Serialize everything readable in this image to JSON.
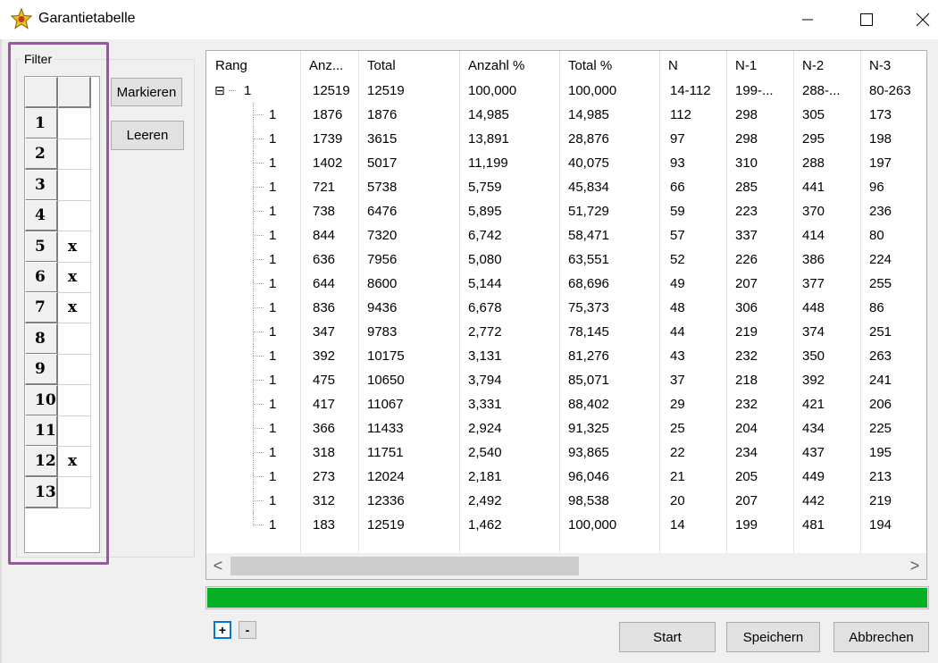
{
  "window": {
    "title": "Garantietabelle",
    "controls": {
      "minimize": "—",
      "maximize": "☐",
      "close": "✕"
    }
  },
  "filter": {
    "legend": "Filter",
    "rows": [
      {
        "label": "1",
        "value": ""
      },
      {
        "label": "2",
        "value": ""
      },
      {
        "label": "3",
        "value": ""
      },
      {
        "label": "4",
        "value": ""
      },
      {
        "label": "5",
        "value": "x"
      },
      {
        "label": "6",
        "value": "x"
      },
      {
        "label": "7",
        "value": "x"
      },
      {
        "label": "8",
        "value": ""
      },
      {
        "label": "9",
        "value": ""
      },
      {
        "label": "10",
        "value": ""
      },
      {
        "label": "11",
        "value": ""
      },
      {
        "label": "12",
        "value": "x"
      },
      {
        "label": "13",
        "value": ""
      }
    ],
    "highlight_color": "#a052ab"
  },
  "buttons": {
    "markieren": "Markieren",
    "leeren": "Leeren",
    "start": "Start",
    "speichern": "Speichern",
    "abbrechen": "Abbrechen",
    "expand": "+",
    "collapse": "-"
  },
  "table": {
    "columns": [
      "Rang",
      "Anz...",
      "Total",
      "Anzahl %",
      "Total %",
      "N",
      "N-1",
      "N-2",
      "N-3"
    ],
    "root": {
      "toggle": "⊟",
      "cells": [
        "1",
        "12519",
        "12519",
        "100,000",
        "100,000",
        "14-112",
        "199-...",
        "288-...",
        "80-263"
      ]
    },
    "rows": [
      [
        "1",
        "1876",
        "1876",
        "14,985",
        "14,985",
        "112",
        "298",
        "305",
        "173"
      ],
      [
        "1",
        "1739",
        "3615",
        "13,891",
        "28,876",
        "97",
        "298",
        "295",
        "198"
      ],
      [
        "1",
        "1402",
        "5017",
        "11,199",
        "40,075",
        "93",
        "310",
        "288",
        "197"
      ],
      [
        "1",
        "721",
        "5738",
        "5,759",
        "45,834",
        "66",
        "285",
        "441",
        "96"
      ],
      [
        "1",
        "738",
        "6476",
        "5,895",
        "51,729",
        "59",
        "223",
        "370",
        "236"
      ],
      [
        "1",
        "844",
        "7320",
        "6,742",
        "58,471",
        "57",
        "337",
        "414",
        "80"
      ],
      [
        "1",
        "636",
        "7956",
        "5,080",
        "63,551",
        "52",
        "226",
        "386",
        "224"
      ],
      [
        "1",
        "644",
        "8600",
        "5,144",
        "68,696",
        "49",
        "207",
        "377",
        "255"
      ],
      [
        "1",
        "836",
        "9436",
        "6,678",
        "75,373",
        "48",
        "306",
        "448",
        "86"
      ],
      [
        "1",
        "347",
        "9783",
        "2,772",
        "78,145",
        "44",
        "219",
        "374",
        "251"
      ],
      [
        "1",
        "392",
        "10175",
        "3,131",
        "81,276",
        "43",
        "232",
        "350",
        "263"
      ],
      [
        "1",
        "475",
        "10650",
        "3,794",
        "85,071",
        "37",
        "218",
        "392",
        "241"
      ],
      [
        "1",
        "417",
        "11067",
        "3,331",
        "88,402",
        "29",
        "232",
        "421",
        "206"
      ],
      [
        "1",
        "366",
        "11433",
        "2,924",
        "91,325",
        "25",
        "204",
        "434",
        "225"
      ],
      [
        "1",
        "318",
        "11751",
        "2,540",
        "93,865",
        "22",
        "234",
        "437",
        "195"
      ],
      [
        "1",
        "273",
        "12024",
        "2,181",
        "96,046",
        "21",
        "205",
        "449",
        "213"
      ],
      [
        "1",
        "312",
        "12336",
        "2,492",
        "98,538",
        "20",
        "207",
        "442",
        "219"
      ],
      [
        "1",
        "183",
        "12519",
        "1,462",
        "100,000",
        "14",
        "199",
        "481",
        "194"
      ]
    ],
    "scroll": {
      "left": "<",
      "right": ">"
    }
  },
  "progress": {
    "fraction": 1.0,
    "color": "#06b025"
  }
}
